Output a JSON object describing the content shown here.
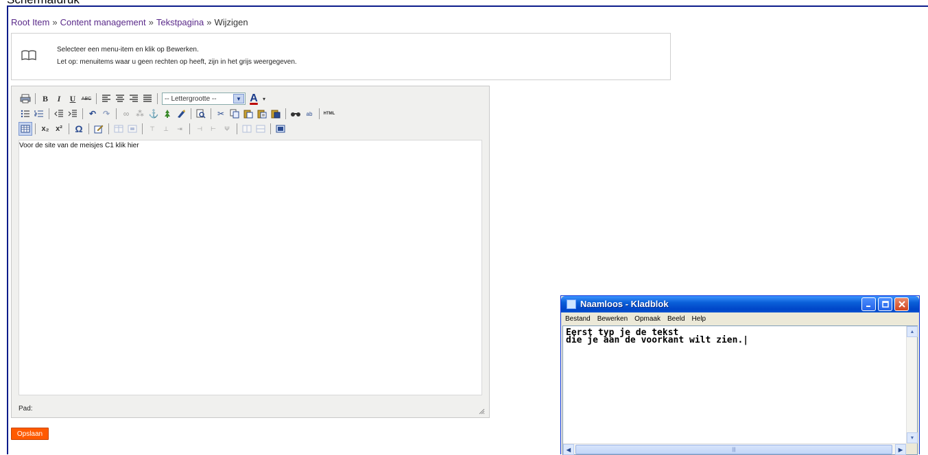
{
  "page": {
    "top_label": "Schermafdruk"
  },
  "breadcrumb": {
    "items": [
      "Root Item",
      "Content management",
      "Tekstpagina",
      "Wijzigen"
    ],
    "separator": "»"
  },
  "info": {
    "line1": "Selecteer een menu-item en klik op Bewerken.",
    "line2": "Let op: menuitems waar u geen rechten op heeft, zijn in het grijs weergegeven."
  },
  "editor": {
    "font_size_placeholder": "-- Lettergrootte --",
    "content": "Voor de site van de meisjes C1 klik hier",
    "status_label": "Pad:",
    "html_button": "HTML",
    "toolbar_icons_row1": [
      "print-icon",
      "bold-icon",
      "italic-icon",
      "underline-icon",
      "strikethrough-icon",
      "align-left-icon",
      "align-center-icon",
      "align-right-icon",
      "align-justify-icon",
      "font-color-icon"
    ],
    "toolbar_icons_row2": [
      "bullet-list-icon",
      "numbered-list-icon",
      "outdent-icon",
      "indent-icon",
      "undo-icon",
      "redo-icon",
      "link-icon",
      "unlink-icon",
      "anchor-icon",
      "image-icon",
      "cleanup-icon",
      "preview-icon",
      "cut-icon",
      "copy-icon",
      "paste-icon",
      "paste-text-icon",
      "paste-word-icon",
      "find-icon",
      "replace-icon",
      "html-icon"
    ],
    "toolbar_icons_row3": [
      "table-icon",
      "subscript-icon",
      "superscript-icon",
      "special-char-icon",
      "edit-icon",
      "table-props-icon",
      "cell-props-icon",
      "row-before-icon",
      "row-after-icon",
      "delete-row-icon",
      "col-before-icon",
      "col-after-icon",
      "delete-col-icon",
      "split-cells-icon",
      "merge-cells-icon",
      "fullscreen-icon"
    ]
  },
  "actions": {
    "save_label": "Opslaan"
  },
  "notepad": {
    "title": "Naamloos - Kladblok",
    "menu": [
      "Bestand",
      "Bewerken",
      "Opmaak",
      "Beeld",
      "Help"
    ],
    "text": "Eerst typ je de tekst\ndie je aan de voorkant wilt zien.|",
    "colors": {
      "titlebar": "#0a5fd8",
      "close": "#d2451f"
    }
  },
  "colors": {
    "save_button": "#ff5a00",
    "link": "#5a2a8a",
    "frame_border": "#0a1b8a"
  }
}
